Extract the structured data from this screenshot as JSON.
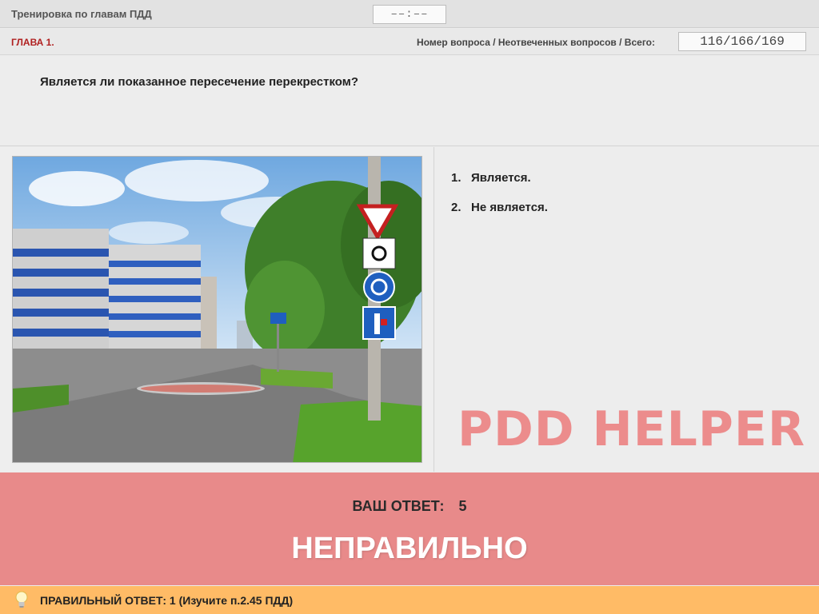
{
  "header": {
    "title": "Тренировка по главам ПДД",
    "timer": "––:––"
  },
  "chapter_bar": {
    "chapter": "ГЛАВА 1.",
    "counter_label": "Номер вопроса / Неотвеченных вопросов / Всего:",
    "counter": "116/166/169"
  },
  "question": {
    "text": "Является ли показанное пересечение перекрестком?"
  },
  "answers": [
    {
      "num": "1.",
      "text": "Является."
    },
    {
      "num": "2.",
      "text": "Не является."
    }
  ],
  "watermark": "PDD HELPER",
  "result": {
    "your_label": "ВАШ  ОТВЕТ:",
    "your_value": "5",
    "verdict": "НЕПРАВИЛЬНО"
  },
  "correct": {
    "text": "ПРАВИЛЬНЫЙ ОТВЕТ:   1   (Изучите п.2.45 ПДД)",
    "icon": "lightbulb-icon"
  },
  "colors": {
    "result_bg": "#e88a8a",
    "correct_bg": "#ffbb66",
    "chapter_red": "#b02020",
    "watermark": "#ec8c8c"
  }
}
